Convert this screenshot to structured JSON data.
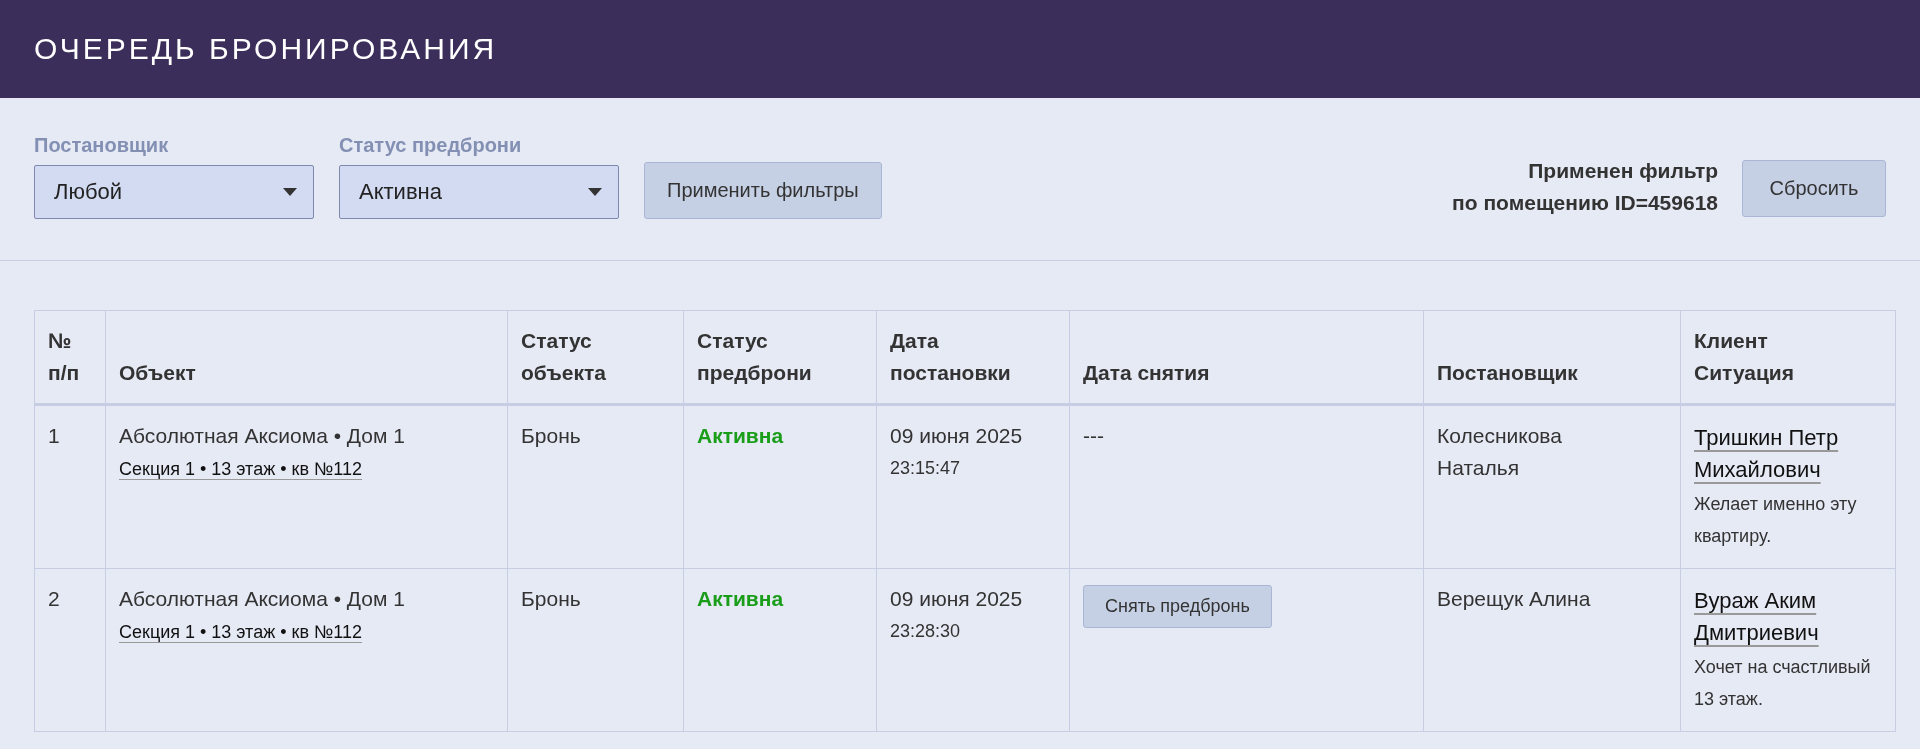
{
  "header": {
    "title": "ОЧЕРЕДЬ БРОНИРОВАНИЯ"
  },
  "filters": {
    "fields": [
      {
        "label": "Постановщик",
        "value": "Любой"
      },
      {
        "label": "Статус предброни",
        "value": "Активна"
      }
    ],
    "apply_button": "Применить фильтры",
    "applied_note": [
      "Применен фильтр",
      "по помещению ID=459618"
    ],
    "reset_button": "Сбросить"
  },
  "table": {
    "columns": [
      [
        "№",
        "п/п"
      ],
      [
        "Объект"
      ],
      [
        "Статус",
        "объекта"
      ],
      [
        "Статус",
        "предброни"
      ],
      [
        "Дата",
        "постановки"
      ],
      [
        "Дата снятия"
      ],
      [
        "Постановщик"
      ],
      [
        "Клиент",
        "Ситуация"
      ]
    ],
    "rows": [
      {
        "number": "1",
        "object": "Абсолютная Аксиома • Дом 1",
        "unit": "Секция 1 • 13 этаж • кв №112",
        "object_status": "Бронь",
        "booking_status": "Активна",
        "color": "#1a9e1a",
        "date": "09 июня 2025",
        "time": "23:15:47",
        "removal": {
          "kind": "text",
          "text": "---"
        },
        "creator": "Колесникова Наталья",
        "client": "Тришкин Петр Михайлович",
        "situation": "Желает именно эту квартиру."
      },
      {
        "number": "2",
        "object": "Абсолютная Аксиома • Дом 1",
        "unit": "Секция 1 • 13 этаж • кв №112",
        "object_status": "Бронь",
        "booking_status": "Активна",
        "color": "#1a9e1a",
        "date": "09 июня 2025",
        "time": "23:28:30",
        "removal": {
          "kind": "button",
          "text": "Снять предбронь"
        },
        "creator": "Верещук Алина",
        "client": "Вураж Аким Дмитриевич",
        "situation": "Хочет на счастливый 13 этаж."
      }
    ]
  }
}
